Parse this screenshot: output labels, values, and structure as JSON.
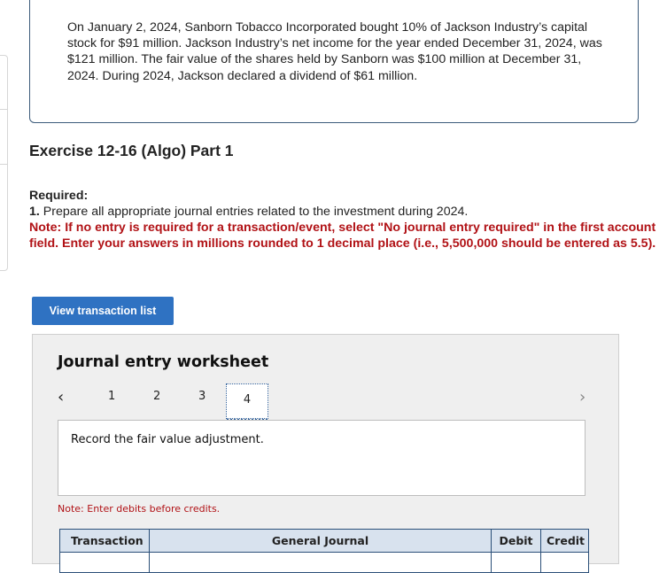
{
  "problem": {
    "text": "On January 2, 2024, Sanborn Tobacco Incorporated bought 10% of Jackson Industry’s capital stock for $91 million. Jackson Industry’s net income for the year ended December 31, 2024, was $121 million. The fair value of the shares held by Sanborn was $100 million at December 31, 2024. During 2024, Jackson declared a dividend of $61 million."
  },
  "exercise": {
    "title": "Exercise 12-16 (Algo) Part 1"
  },
  "required": {
    "label": "Required:",
    "item_number": "1.",
    "item_text": "Prepare all appropriate journal entries related to the investment during 2024.",
    "note": "Note: If no entry is required for a transaction/event, select \"No journal entry required\" in the first account field. Enter your answers in millions rounded to 1 decimal place (i.e., 5,500,000 should be entered as 5.5)."
  },
  "view_button": {
    "label": "View transaction list",
    "color": "#2f72c2"
  },
  "worksheet": {
    "title": "Journal entry worksheet",
    "pages": [
      "1",
      "2",
      "3",
      "4"
    ],
    "active_page": "4",
    "prev_icon": "‹",
    "next_icon": "›",
    "description": "Record the fair value adjustment.",
    "note": "Note: Enter debits before credits.",
    "columns": {
      "transaction": "Transaction",
      "general_journal": "General Journal",
      "debit": "Debit",
      "credit": "Credit"
    }
  },
  "colors": {
    "note_red": "#b11216",
    "border_navy": "#2b4f78"
  }
}
